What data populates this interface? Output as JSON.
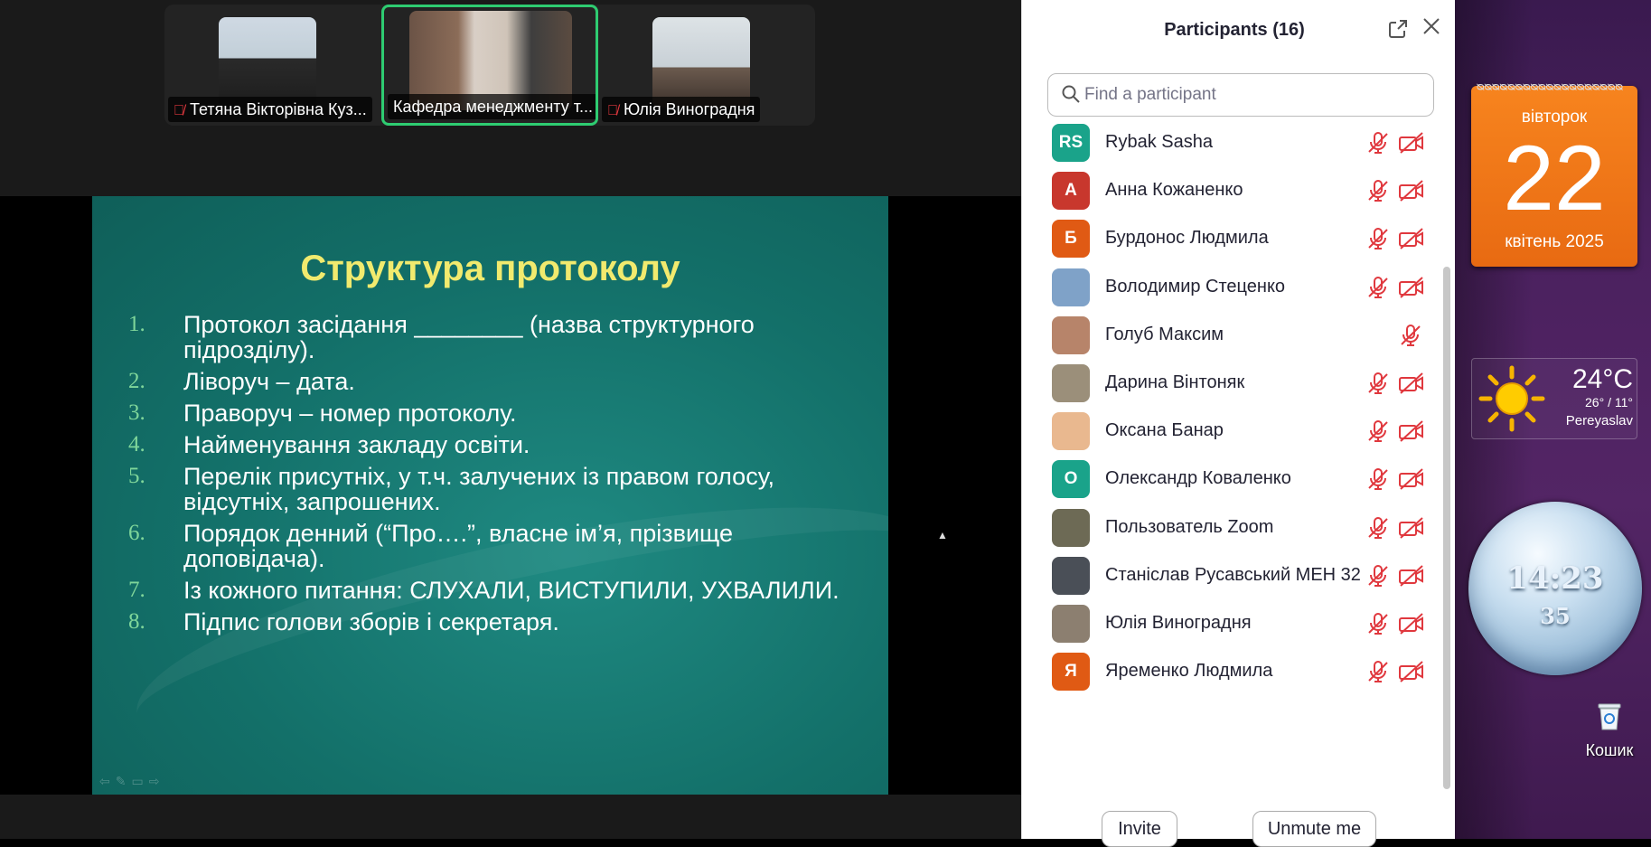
{
  "meeting": {
    "videos": [
      {
        "name": "Тетяна Вікторівна Куз...",
        "muted": true
      },
      {
        "name": "Кафедра менеджменту т...",
        "muted": false,
        "active_speaker": true
      },
      {
        "name": "Юлія Виноградня",
        "muted": true
      }
    ],
    "slide": {
      "title": "Структура протоколу",
      "items": [
        {
          "num": "1.",
          "text": "Протокол засідання ________ (назва структурного підрозділу)."
        },
        {
          "num": "2.",
          "text": "Ліворуч – дата."
        },
        {
          "num": "3.",
          "text": "Праворуч – номер протоколу."
        },
        {
          "num": "4.",
          "text": "Найменування закладу освіти."
        },
        {
          "num": "5.",
          "text": "Перелік присутніх, у т.ч. залучених із правом голосу, відсутніх, запрошених."
        },
        {
          "num": "6.",
          "text": "Порядок денний (“Про….”, власне ім’я, прізвище доповідача)."
        },
        {
          "num": "7.",
          "text": "Із кожного питання: СЛУХАЛИ, ВИСТУПИЛИ, УХВАЛИЛИ."
        },
        {
          "num": "8.",
          "text": "Підпис голови зборів і секретаря."
        }
      ]
    }
  },
  "participants_panel": {
    "title": "Participants (16)",
    "search_placeholder": "Find a participant",
    "participants": [
      {
        "initials": "RS",
        "avatar_color": "#1aa38a",
        "name": "Rybak Sasha",
        "mic_muted": true,
        "cam_off": true
      },
      {
        "initials": "А",
        "avatar_color": "#c8372d",
        "name": "Анна Кожаненко",
        "mic_muted": true,
        "cam_off": true
      },
      {
        "initials": "Б",
        "avatar_color": "#e05a14",
        "name": "Бурдонос Людмила",
        "mic_muted": true,
        "cam_off": true
      },
      {
        "initials": "",
        "avatar_color": "#7fa2c8",
        "name": "Володимир Стеценко",
        "mic_muted": true,
        "cam_off": true
      },
      {
        "initials": "",
        "avatar_color": "#b7846a",
        "name": "Голуб Максим",
        "mic_muted": true,
        "cam_off": false
      },
      {
        "initials": "",
        "avatar_color": "#9b8f7a",
        "name": "Дарина Вінтоняк",
        "mic_muted": true,
        "cam_off": true
      },
      {
        "initials": "",
        "avatar_color": "#e9b88f",
        "name": "Оксана Банар",
        "mic_muted": true,
        "cam_off": true
      },
      {
        "initials": "О",
        "avatar_color": "#1aa38a",
        "name": "Олександр Коваленко",
        "mic_muted": true,
        "cam_off": true
      },
      {
        "initials": "",
        "avatar_color": "#6d6a55",
        "name": "Пользователь Zoom",
        "mic_muted": true,
        "cam_off": true
      },
      {
        "initials": "",
        "avatar_color": "#4a4f57",
        "name": "Станіслав Русавський МЕН 32",
        "mic_muted": true,
        "cam_off": true
      },
      {
        "initials": "",
        "avatar_color": "#8c7f70",
        "name": "Юлія Виноградня",
        "mic_muted": true,
        "cam_off": true
      },
      {
        "initials": "Я",
        "avatar_color": "#e05a14",
        "name": "Яременко Людмила",
        "mic_muted": true,
        "cam_off": true
      }
    ],
    "invite_label": "Invite",
    "unmute_label": "Unmute me"
  },
  "desktop": {
    "calendar": {
      "weekday": "вівторок",
      "day": "22",
      "month_year": "квітень 2025"
    },
    "weather": {
      "temp": "24°C",
      "range": "26° / 11°",
      "city": "Pereyaslav"
    },
    "clock": {
      "time": "14:23",
      "seconds": "35"
    },
    "recycle_bin_label": "Кошик"
  }
}
